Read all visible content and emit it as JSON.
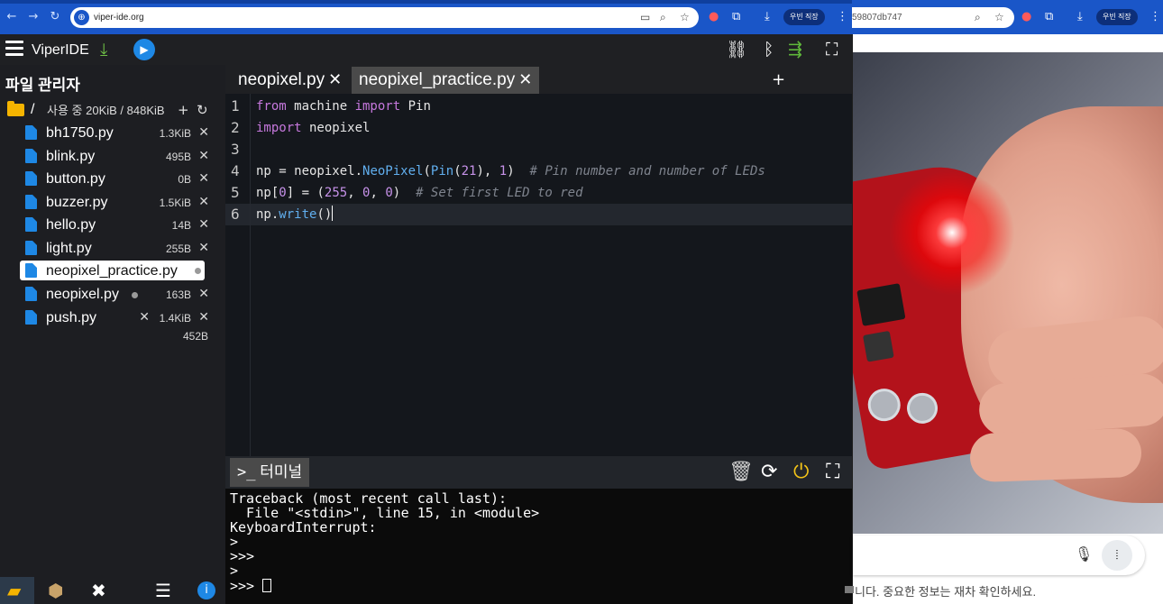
{
  "browser": {
    "url": "viper-ide.org",
    "profile_label": "우빈 직장",
    "right_url": "59807db747",
    "right_profile_label": "우빈 직장"
  },
  "app": {
    "title": "ViperIDE"
  },
  "sidebar": {
    "title": "파일 관리자",
    "folder_path": "/",
    "usage": "사용 중 20KiB / 848KiB",
    "files": [
      {
        "name": "bh1750.py",
        "size": "1.3KiB"
      },
      {
        "name": "blink.py",
        "size": "495B"
      },
      {
        "name": "button.py",
        "size": "0B"
      },
      {
        "name": "buzzer.py",
        "size": "1.5KiB"
      },
      {
        "name": "hello.py",
        "size": "14B"
      },
      {
        "name": "light.py",
        "size": "255B"
      },
      {
        "name": "neopixel_practice.py",
        "size": ""
      },
      {
        "name": "neopixel.py",
        "size": "163B"
      },
      {
        "name": "push.py",
        "size": "1.4KiB"
      }
    ],
    "total": "452B"
  },
  "editor": {
    "tabs": [
      {
        "label": "neopixel.py",
        "close": "✕"
      },
      {
        "label": "neopixel_practice.py",
        "close": "✕"
      }
    ],
    "add_tab": "+",
    "line_numbers": [
      "1",
      "2",
      "3",
      "4",
      "5",
      "6"
    ],
    "code": {
      "l1_kw1": "from",
      "l1_mid": " machine ",
      "l1_kw2": "import",
      "l1_end": " Pin",
      "l2_kw": "import",
      "l2_end": " neopixel",
      "l4_a": "np = neopixel.",
      "l4_fn1": "NeoPixel",
      "l4_b": "(",
      "l4_fn2": "Pin",
      "l4_c": "(",
      "l4_n1": "21",
      "l4_d": "), ",
      "l4_n2": "1",
      "l4_e": ")  ",
      "l4_cm": "# Pin number and number of LEDs",
      "l5_a": "np[",
      "l5_n0": "0",
      "l5_b": "] = (",
      "l5_n1": "255",
      "l5_c": ", ",
      "l5_n2": "0",
      "l5_d": ", ",
      "l5_n3": "0",
      "l5_e": ")  ",
      "l5_cm": "# Set first LED to red",
      "l6_a": "np.",
      "l6_fn": "write",
      "l6_b": "()"
    }
  },
  "terminal": {
    "tab_label": "터미널",
    "lines": [
      "Traceback (most recent call last):",
      "  File \"<stdin>\", line 15, in <module>",
      "KeyboardInterrupt:",
      ">",
      ">>>",
      ">",
      ">>> "
    ]
  },
  "right_panel": {
    "footer_note": "니다. 중요한 정보는 재차 확인하세요."
  },
  "colors": {
    "accent_blue": "#1a56c8",
    "usb_green": "#5fb83a",
    "power_yellow": "#f5c518"
  }
}
